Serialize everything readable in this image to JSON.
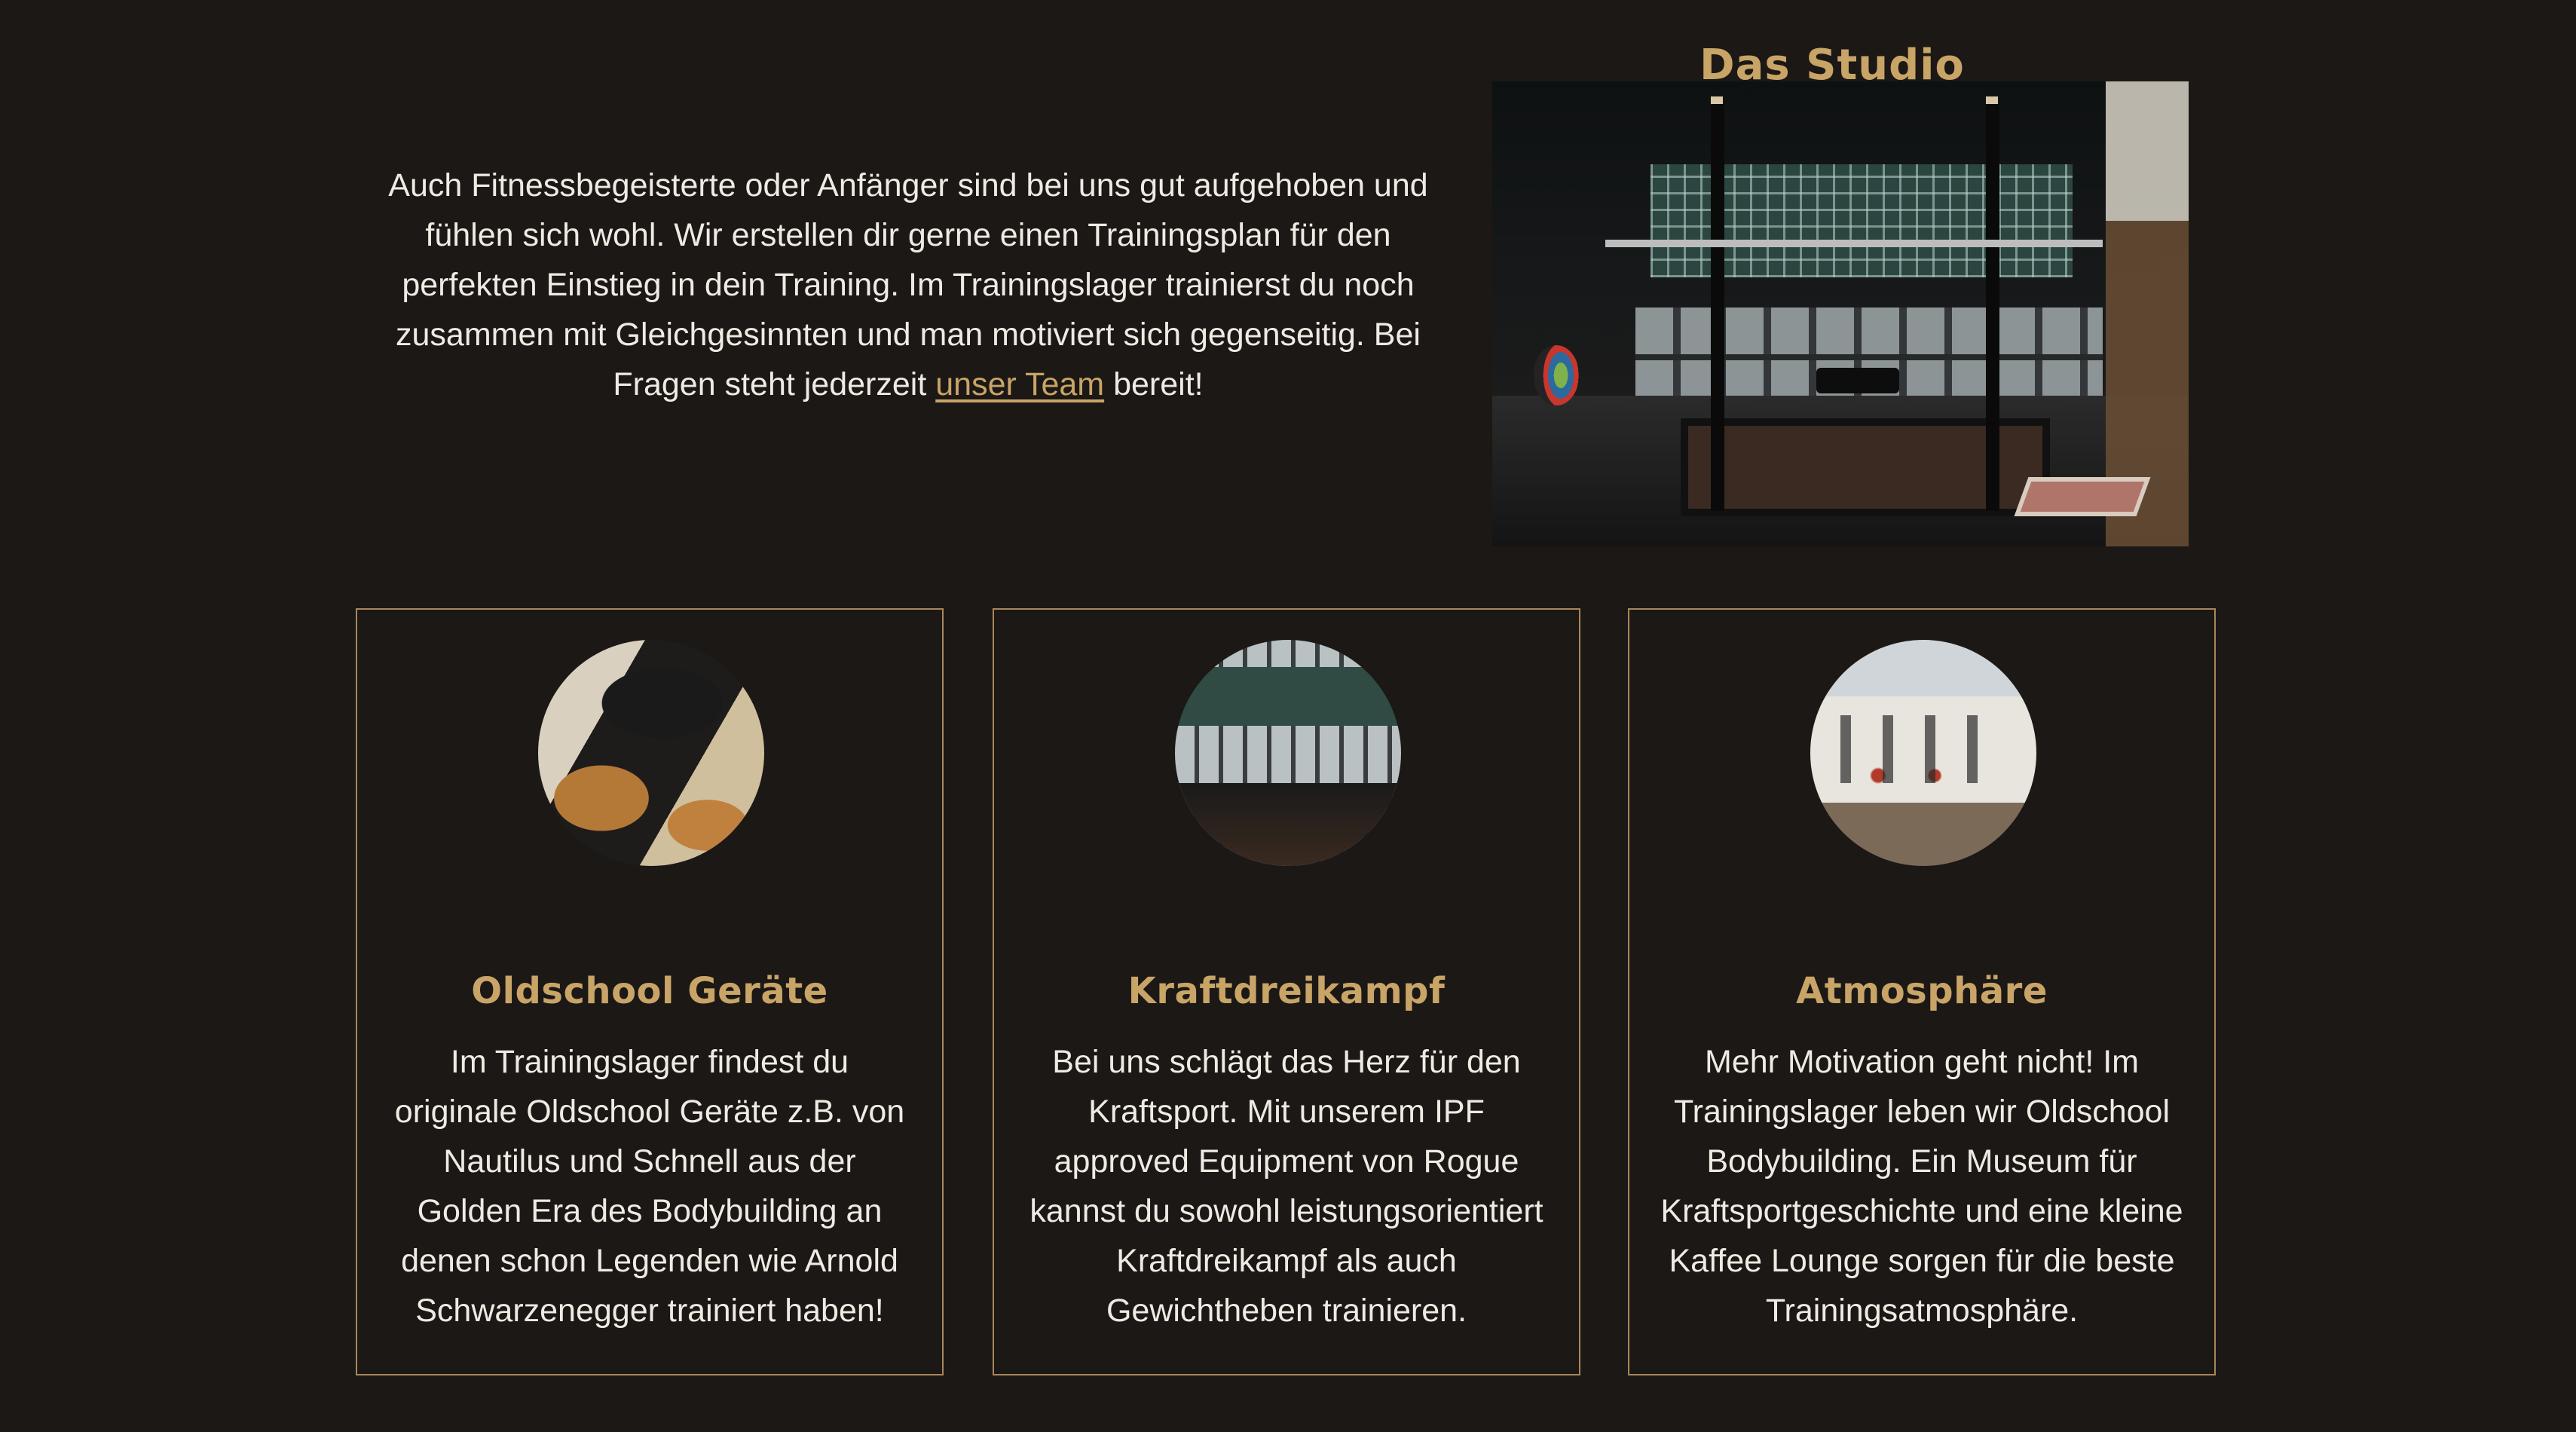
{
  "studio": {
    "title": "Das Studio",
    "intro_before_link": "Auch Fitnessbegeisterte oder Anfänger sind bei uns gut aufgehoben und fühlen sich wohl. Wir erstellen dir gerne einen Trainingsplan für den perfekten Einstieg in dein Training. Im Trainingslager trainierst du noch zusammen mit Gleichgesinnten und man motiviert sich gegenseitig. Bei Fragen steht jederzeit ",
    "intro_link": "unser Team",
    "intro_after_link": " bereit!",
    "photo_label": "studio-photo"
  },
  "cards": [
    {
      "title": "Oldschool Geräte",
      "text": "Im Trainingslager findest du originale Oldschool Geräte z.B. von Nautilus und Schnell aus der Golden Era des Bodybuilding an denen schon Legenden wie Arnold Schwarzenegger trainiert haben!"
    },
    {
      "title": "Kraftdreikampf",
      "text": "Bei uns schlägt das Herz für den Kraftsport. Mit unserem IPF approved Equipment von Rogue kannst du sowohl leistungsorientiert Kraftdreikampf als auch Gewichtheben trainieren."
    },
    {
      "title": "Atmosphäre",
      "text": "Mehr Motivation geht nicht! Im Trainingslager leben wir Oldschool Bodybuilding. Ein Museum für Kraftsportgeschichte und eine kleine Kaffee Lounge sorgen für die beste Trainingsatmosphäre."
    }
  ],
  "colors": {
    "background": "#1b1816",
    "accent": "#c9a467",
    "card_border": "#a8875a",
    "text": "#efeae2"
  }
}
